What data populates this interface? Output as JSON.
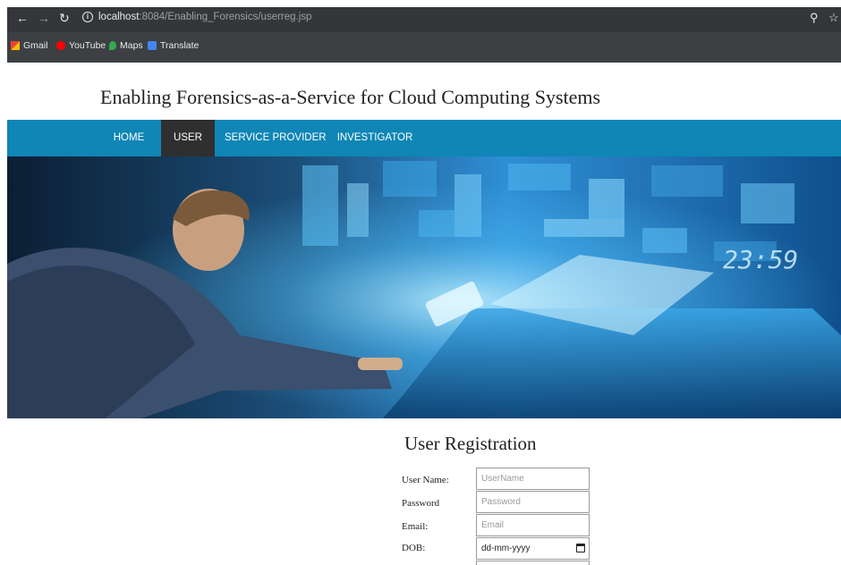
{
  "browser": {
    "url_host": "localhost",
    "url_path": ":8084/Enabling_Forensics/userreg.jsp",
    "bookmarks": [
      {
        "label": "Gmail",
        "icon": "gmail-icon",
        "color": "#ea4335"
      },
      {
        "label": "YouTube",
        "icon": "youtube-icon",
        "color": "#ff0000"
      },
      {
        "label": "Maps",
        "icon": "maps-icon",
        "color": "#34a853"
      },
      {
        "label": "Translate",
        "icon": "translate-icon",
        "color": "#4285f4"
      }
    ]
  },
  "site": {
    "title": "Enabling Forensics-as-a-Service for Cloud Computing Systems"
  },
  "nav": {
    "items": [
      {
        "label": "HOME",
        "active": false
      },
      {
        "label": "USER",
        "active": true
      },
      {
        "label": "SERVICE PROVIDER",
        "active": false
      },
      {
        "label": "INVESTIGATOR",
        "active": false
      }
    ],
    "bar_color": "#0f86b5"
  },
  "banner": {
    "clock_text": "23:59"
  },
  "form": {
    "title": "User Registration",
    "fields": [
      {
        "label": "User Name:",
        "placeholder": "UserName"
      },
      {
        "label": "Password",
        "placeholder": "Password"
      },
      {
        "label": "Email:",
        "placeholder": "Email"
      },
      {
        "label": "DOB:",
        "placeholder": "dd-mm-yyyy"
      }
    ]
  }
}
